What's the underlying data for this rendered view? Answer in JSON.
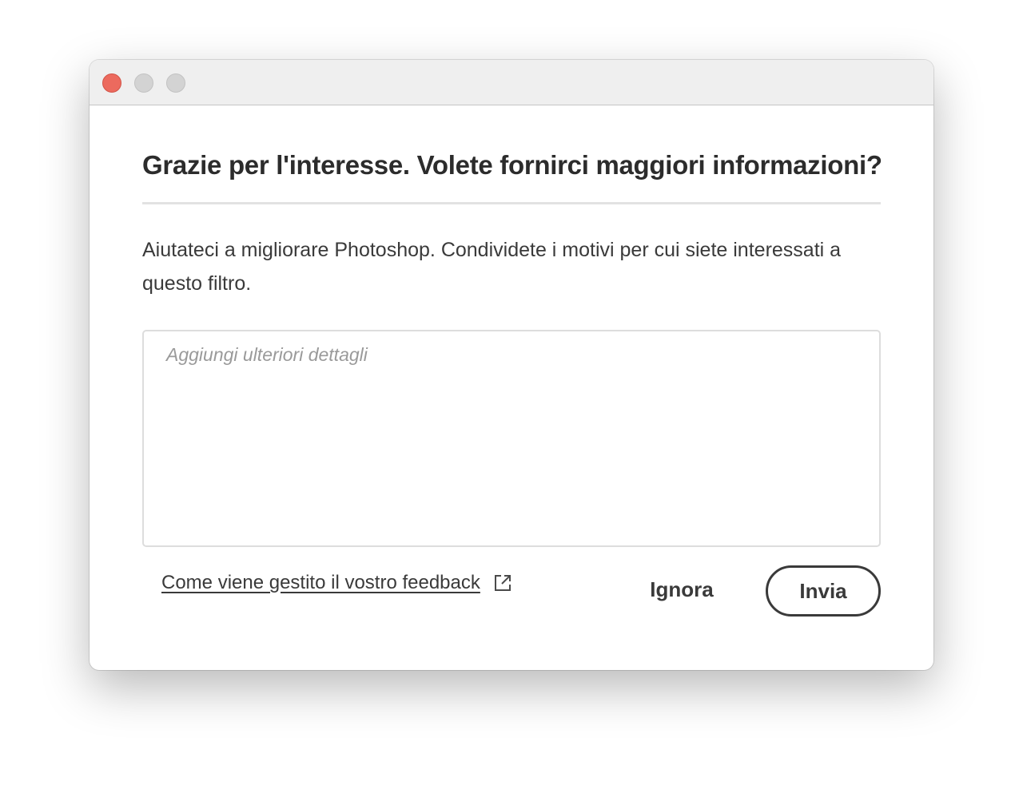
{
  "window": {
    "controls": [
      "close-button",
      "minimize-button",
      "zoom-button"
    ]
  },
  "dialog": {
    "heading": "Grazie per l'interesse. Volete fornirci maggiori informazioni?",
    "description": "Aiutateci a migliorare Photoshop. Condividete i motivi per cui siete interessati a questo filtro.",
    "details_placeholder": "Aggiungi ulteriori dettagli",
    "details_value": "",
    "feedback_link_label": "Come viene gestito il vostro feedback",
    "feedback_link_icon": "external-link-icon",
    "ignore_label": "Ignora",
    "send_label": "Invia"
  },
  "colors": {
    "close": "#ec6a5e",
    "inactive_control": "#d3d3d3",
    "text": "#3a3a3a",
    "heading": "#2c2c2c"
  }
}
